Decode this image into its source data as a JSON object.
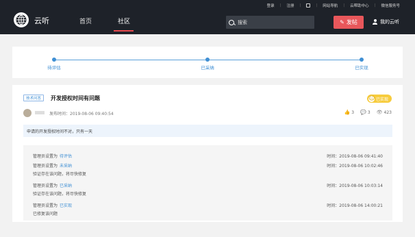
{
  "header": {
    "brand": "云听",
    "links": [
      "登录",
      "注册",
      "网站导航",
      "云帮助中心",
      "微信服务号"
    ],
    "nav": [
      "首页",
      "社区"
    ],
    "search_placeholder": "搜索",
    "post_label": "发帖",
    "my_label": "我的云听"
  },
  "progress": {
    "steps": [
      "待评估",
      "已采纳",
      "已实现"
    ]
  },
  "post": {
    "tag": "技术问答",
    "title": "开发授权时间有问题",
    "status": "已实现",
    "publish_time": "发布时间：2019-08-06 09:40:54",
    "likes": "3",
    "comments": "3",
    "views": "423",
    "description": "申请的开发授权时间不对，只有一天"
  },
  "history": [
    {
      "prefix": "管理员设置为",
      "value": "待评估",
      "note": "",
      "time": "时间：2019-08-06 09:41:40"
    },
    {
      "prefix": "管理员设置为",
      "value": "未采纳",
      "note": "验证存在该问题，将尽快修复",
      "time": "时间：2019-08-06 10:02:46"
    },
    {
      "prefix": "管理员设置为",
      "value": "已采纳",
      "note": "验证存在该问题，将尽快修复",
      "time": "时间：2019-08-06 10:03:14"
    },
    {
      "prefix": "管理员设置为",
      "value": "已实现",
      "note": "已修复该问题",
      "time": "时间：2019-08-06 14:00:21"
    }
  ]
}
